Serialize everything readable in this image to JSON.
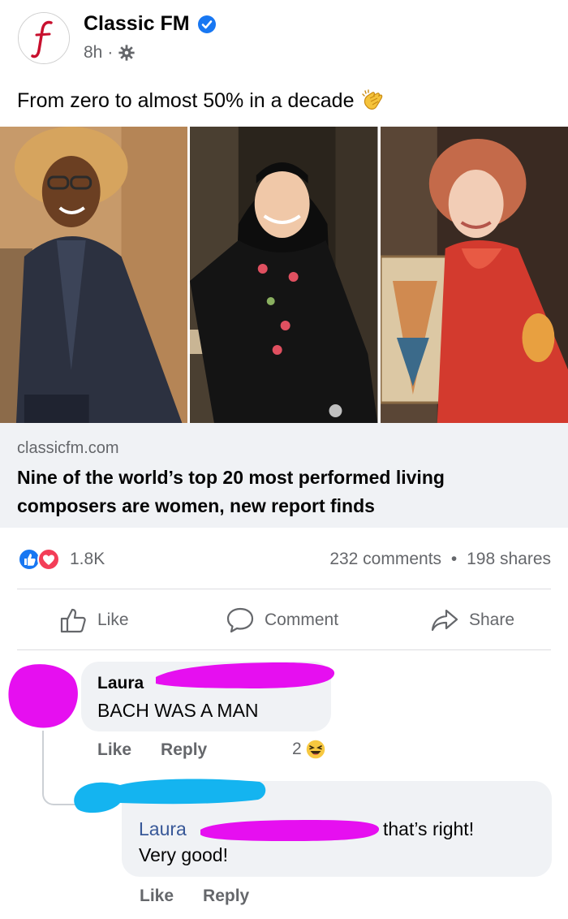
{
  "post": {
    "page_name": "Classic FM",
    "time": "8h",
    "dot": "·",
    "caption": "From zero to almost 50% in a decade",
    "caption_emoji": "clapping-hands-emoji"
  },
  "link": {
    "domain": "classicfm.com",
    "headline": "Nine of the world’s top 20 most performed living composers are women, new report finds"
  },
  "stats": {
    "reactions": "1.8K",
    "comments": "232 comments",
    "separator": "•",
    "shares": "198 shares"
  },
  "actions": {
    "like": "Like",
    "comment": "Comment",
    "share": "Share"
  },
  "comments": [
    {
      "name": "Laura",
      "text": "BACH WAS A MAN",
      "like": "Like",
      "reply": "Reply",
      "reaction_count": "2",
      "reaction_icon": "laughing-emoji"
    }
  ],
  "reply": {
    "mention": "Laura",
    "text_after": "that’s right!",
    "text": "Very good!",
    "like": "Like",
    "reply": "Reply"
  },
  "colors": {
    "brand_red": "#c8102e",
    "fb_blue": "#1877f2",
    "redact_pink": "#e60ff0",
    "redact_blue": "#14b4f0"
  }
}
